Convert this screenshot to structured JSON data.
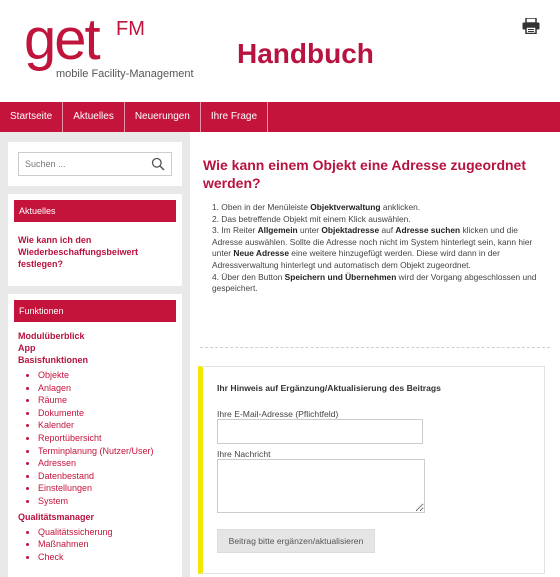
{
  "header": {
    "logo_main": "get",
    "logo_sup": "FM",
    "logo_sub": "mobile Facility-Management",
    "site_title": "Handbuch",
    "print_icon": "printer-icon"
  },
  "nav": {
    "items": [
      "Startseite",
      "Aktuelles",
      "Neuerungen",
      "Ihre Frage"
    ]
  },
  "sidebar": {
    "search_placeholder": "Suchen ...",
    "search_icon": "magnifier-icon",
    "aktuelles_title": "Aktuelles",
    "aktuelles_link": "Wie kann ich den Wiederbeschaffungsbeiwert festlegen?",
    "funktionen_title": "Funktionen",
    "funktionen": {
      "modul": "Modulüberblick",
      "app": "App",
      "basis": "Basisfunktionen",
      "basis_items": [
        "Objekte",
        "Anlagen",
        "Räume",
        "Dokumente",
        "Kalender",
        "Reportübersicht",
        "Terminplanung (Nutzer/User)",
        "Adressen",
        "Datenbestand",
        "Einstellungen",
        "System"
      ],
      "qm": "Qualitätsmanager",
      "qm_items": [
        "Qualitätssicherung",
        "Maßnahmen",
        "Check"
      ]
    }
  },
  "main": {
    "title": "Wie kann einem Objekt eine Adresse zugeordnet werden?",
    "step1_a": "1. Oben in der Menüleiste ",
    "step1_b": "Objektverwaltung",
    "step1_c": " anklicken.",
    "step2": "2. Das betreffende Objekt mit einem Klick auswählen.",
    "step3_a": "3. Im Reiter ",
    "step3_b": "Allgemein",
    "step3_c": " unter ",
    "step3_d": "Objektadresse",
    "step3_e": " auf ",
    "step3_f": "Adresse suchen",
    "step3_g": " klicken und die Adresse auswählen. Sollte die Adresse noch nicht im System hinterlegt sein, kann hier unter ",
    "step3_h": "Neue Adresse",
    "step3_i": " eine weitere hinzugefügt werden. Diese wird dann in der Adressverwaltung hinterlegt und automatisch dem Objekt zugeordnet.",
    "step4_a": "4. Über den Button ",
    "step4_b": "Speichern und Übernehmen",
    "step4_c": " wird der Vorgang abgeschlossen und gespeichert."
  },
  "form": {
    "title": "Ihr Hinweis auf Ergänzung/Aktualisierung des Beitrags",
    "email_label": "Ihre E-Mail-Adresse (Pflichtfeld)",
    "email_value": "",
    "message_label": "Ihre Nachricht",
    "message_value": "",
    "submit_label": "Beitrag bitte ergänzen/aktualisieren"
  },
  "colors": {
    "brand": "#c5143c",
    "accent_bar": "#f5e600"
  }
}
